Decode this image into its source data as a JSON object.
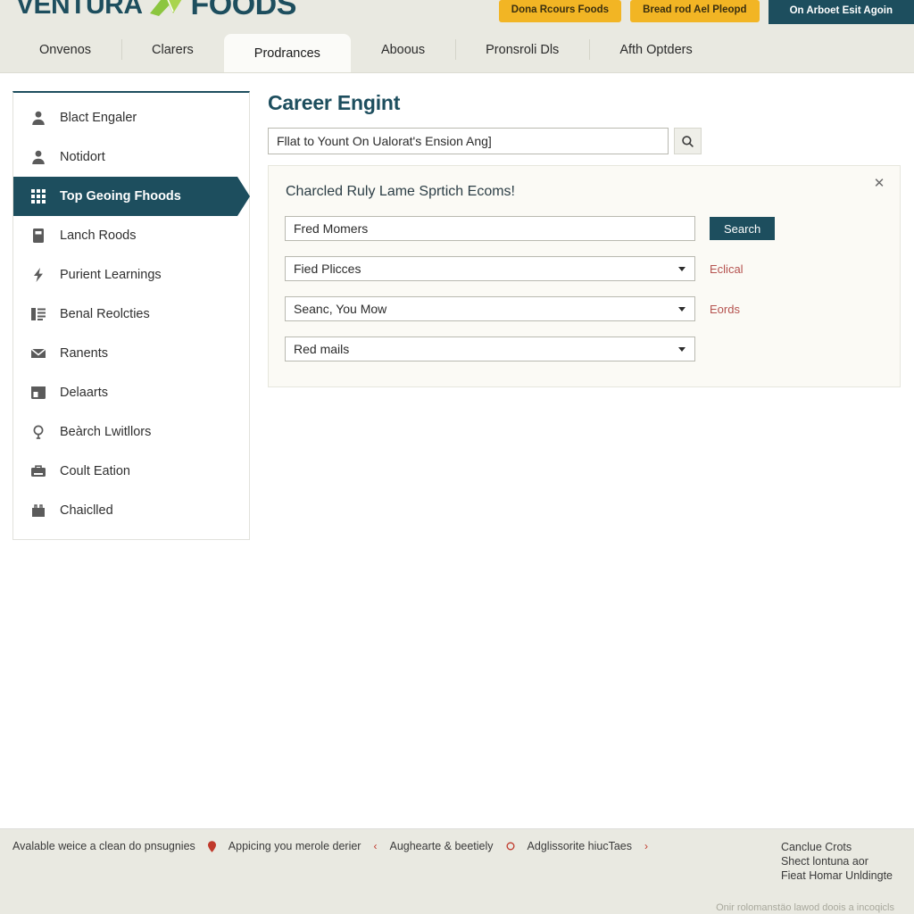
{
  "brand": {
    "name_left": "VENTURA",
    "name_right": "FOODS",
    "logo_icon": "leaf-logo-icon",
    "color": "#1d4e5e",
    "leaf_color": "#8cc63f"
  },
  "header": {
    "actions": [
      {
        "label": "Dona Rcours Foods",
        "style": "amber"
      },
      {
        "label": "Bread rod Ael Pleopd",
        "style": "amber"
      },
      {
        "label": "On Arboet Esit Agoin",
        "style": "teal"
      }
    ]
  },
  "nav": {
    "tabs": [
      {
        "label": "Onvenos",
        "active": false
      },
      {
        "label": "Clarers",
        "active": false
      },
      {
        "label": "Prodrances",
        "active": true
      },
      {
        "label": "Aboous",
        "active": false
      },
      {
        "label": "Pronsroli Dls",
        "active": false
      },
      {
        "label": "Afth Optders",
        "active": false
      }
    ]
  },
  "sidebar": {
    "items": [
      {
        "label": "Blact Engaler",
        "icon": "user-icon",
        "active": false
      },
      {
        "label": "Notidort",
        "icon": "user-icon",
        "active": false
      },
      {
        "label": "Top Geoing Fhoods",
        "icon": "grid-icon",
        "active": true
      },
      {
        "label": "Lanch Roods",
        "icon": "card-icon",
        "active": false
      },
      {
        "label": "Purient Learnings",
        "icon": "bolt-icon",
        "active": false
      },
      {
        "label": "Benal Reolcties",
        "icon": "list-icon",
        "active": false
      },
      {
        "label": "Ranents",
        "icon": "envelope-icon",
        "active": false
      },
      {
        "label": "Delaarts",
        "icon": "window-icon",
        "active": false
      },
      {
        "label": "Beàrch Lwitllors",
        "icon": "lightbulb-icon",
        "active": false
      },
      {
        "label": "Coult Eation",
        "icon": "briefcase-icon",
        "active": false
      },
      {
        "label": "Chaiclled",
        "icon": "bag-icon",
        "active": false
      }
    ]
  },
  "main": {
    "title": "Career Engint",
    "search": {
      "value": "Fllat to Yount On Ualorat's Ension Ang]",
      "placeholder": "Fllat to Yount On Ualorat's Ension Ang]",
      "button_icon": "search-icon"
    },
    "panel": {
      "title": "Charcled Ruly Lame Sprtich Ecoms!",
      "close_icon": "close-icon",
      "rows": [
        {
          "field": "Fred Momers",
          "type": "text",
          "action_label": "Search",
          "action_type": "button"
        },
        {
          "field": "Fied Plicces",
          "type": "select",
          "action_label": "Eclical",
          "action_type": "link"
        },
        {
          "field": "Seanc, You Mow",
          "type": "select",
          "action_label": "Eords",
          "action_type": "link"
        },
        {
          "field": "Red mails",
          "type": "select",
          "action_label": "",
          "action_type": "none"
        }
      ]
    }
  },
  "footer": {
    "links": [
      {
        "label": "Avalable weice a clean do pnsugnies",
        "icon": ""
      },
      {
        "label": "Appicing you merole derier",
        "icon": "pin-icon"
      },
      {
        "label": "Aughearte & beetiely",
        "icon": "chevron-left-icon"
      },
      {
        "label": "Adglissorite hiucTaes",
        "icon": "circle-icon"
      },
      {
        "label": "",
        "icon": "chevron-right-icon"
      }
    ],
    "address": [
      "Canclue Crots",
      "Shect lontuna aor",
      "Fieat Homar Unldingte"
    ],
    "legal": "Onir rolomanstäo lawod doois a incoqicls"
  }
}
